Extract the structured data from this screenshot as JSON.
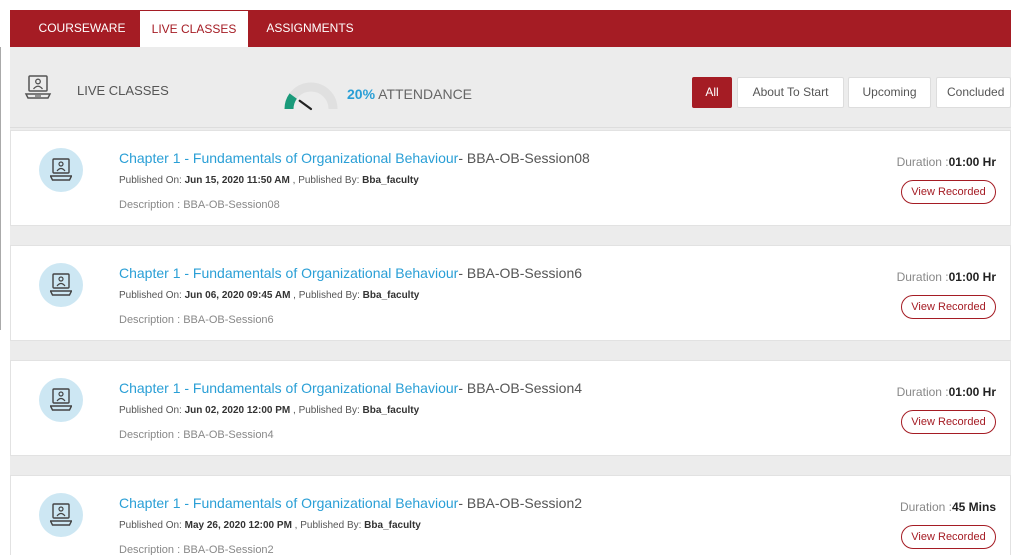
{
  "nav": {
    "tabs": [
      {
        "label": "COURSEWARE",
        "active": false
      },
      {
        "label": "LIVE CLASSES",
        "active": true
      },
      {
        "label": "ASSIGNMENTS",
        "active": false
      }
    ]
  },
  "header": {
    "title": "LIVE CLASSES",
    "attendance_percent": "20%",
    "attendance_label": "ATTENDANCE",
    "attendance_value": 0.2
  },
  "filters": [
    {
      "label": "All",
      "active": true
    },
    {
      "label": "About To Start",
      "active": false
    },
    {
      "label": "Upcoming",
      "active": false
    },
    {
      "label": "Concluded",
      "active": false
    }
  ],
  "classes": [
    {
      "chapter": "Chapter 1 - Fundamentals of Organizational Behaviour",
      "session": "- BBA-OB-Session08",
      "published_on_label": "Published On: ",
      "published_on": "Jun 15, 2020 11:50 AM",
      "published_by_label": " , Published By: ",
      "published_by": "Bba_faculty",
      "description": "Description : BBA-OB-Session08",
      "duration_label": "Duration :",
      "duration": "01:00 Hr",
      "action": "View Recorded"
    },
    {
      "chapter": "Chapter 1 - Fundamentals of Organizational Behaviour",
      "session": "- BBA-OB-Session6",
      "published_on_label": "Published On: ",
      "published_on": "Jun 06, 2020 09:45 AM",
      "published_by_label": " , Published By: ",
      "published_by": "Bba_faculty",
      "description": "Description : BBA-OB-Session6",
      "duration_label": "Duration :",
      "duration": "01:00 Hr",
      "action": "View Recorded"
    },
    {
      "chapter": "Chapter 1 - Fundamentals of Organizational Behaviour",
      "session": "- BBA-OB-Session4",
      "published_on_label": "Published On: ",
      "published_on": "Jun 02, 2020 12:00 PM",
      "published_by_label": " , Published By: ",
      "published_by": "Bba_faculty",
      "description": "Description : BBA-OB-Session4",
      "duration_label": "Duration :",
      "duration": "01:00 Hr",
      "action": "View Recorded"
    },
    {
      "chapter": "Chapter 1 - Fundamentals of Organizational Behaviour",
      "session": "- BBA-OB-Session2",
      "published_on_label": "Published On: ",
      "published_on": "May 26, 2020 12:00 PM",
      "published_by_label": " , Published By: ",
      "published_by": "Bba_faculty",
      "description": "Description : BBA-OB-Session2",
      "duration_label": "Duration :",
      "duration": "45 Mins",
      "action": "View Recorded"
    }
  ],
  "icons": {
    "header": "live-class-laptop-icon",
    "card": "presenter-laptop-icon",
    "gauge": "attendance-gauge"
  },
  "colors": {
    "brand": "#a51c24",
    "link": "#2a9fd6",
    "gauge_fill": "#1a9a7a",
    "gauge_track": "#e0e0e0"
  }
}
